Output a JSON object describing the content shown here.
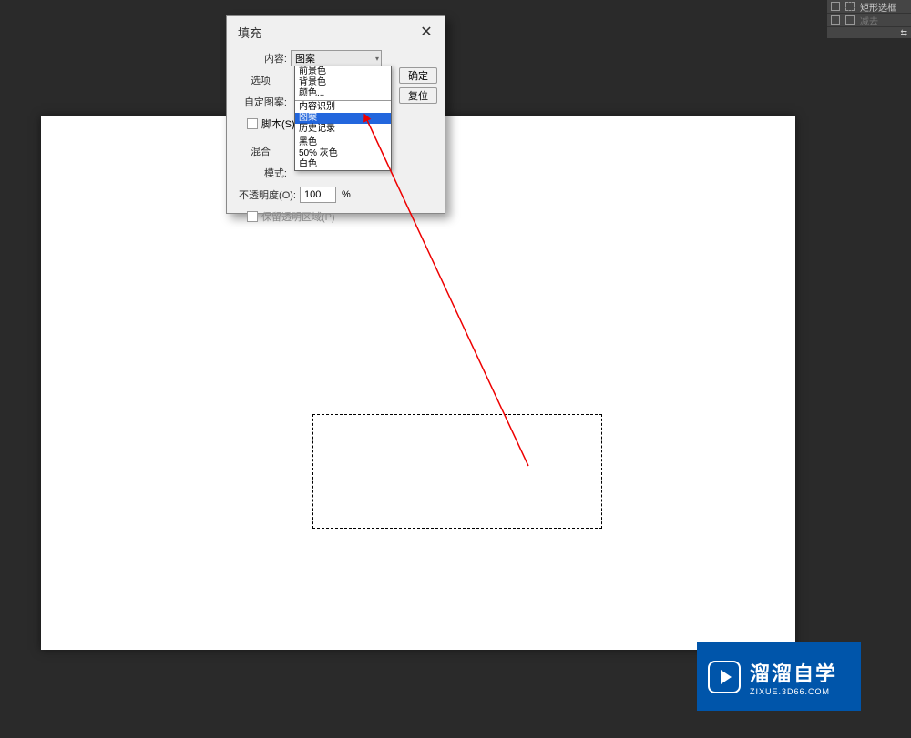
{
  "dialog": {
    "title": "填充",
    "content_label": "内容:",
    "content_value": "图案",
    "options_label": "选项",
    "custom_pattern_label": "自定图案:",
    "script_label": "脚本(S):",
    "blend_label": "混合",
    "mode_label": "模式:",
    "opacity_label": "不透明度(O):",
    "opacity_value": "100",
    "opacity_unit": "%",
    "preserve_transparency_label": "保留透明区域(P)",
    "ok_button": "确定",
    "reset_button": "复位"
  },
  "dropdown_options": {
    "group1": [
      "前景色",
      "背景色",
      "颜色..."
    ],
    "group2": [
      "内容识别",
      "图案",
      "历史记录"
    ],
    "group3": [
      "黑色",
      "50% 灰色",
      "白色"
    ],
    "selected_index": 1
  },
  "right_panel": {
    "item1": "矩形选框",
    "item2": "减去"
  },
  "watermark": {
    "main_text": "溜溜自学",
    "sub_text": "ZIXUE.3D66.COM"
  }
}
